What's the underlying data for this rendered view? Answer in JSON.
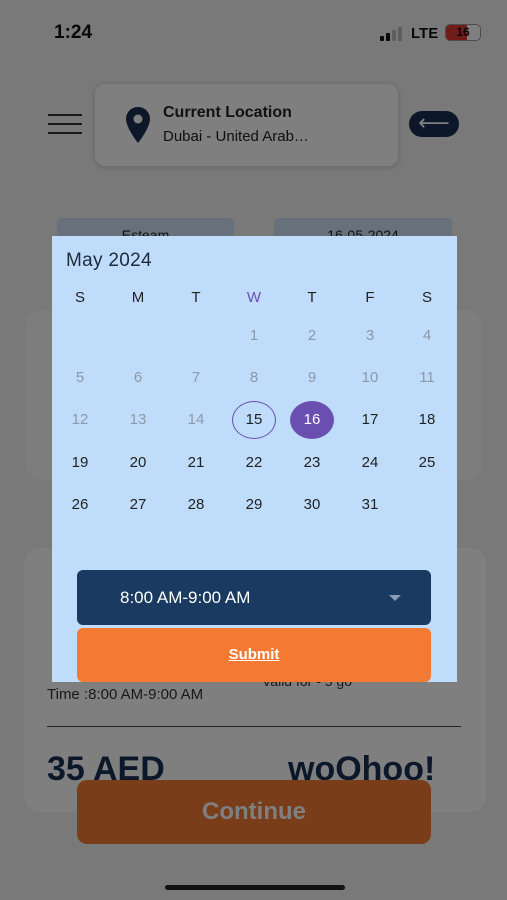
{
  "status": {
    "time": "1:24",
    "network": "LTE",
    "battery": "16",
    "signal_icon": "signal-icon"
  },
  "header": {
    "menu_icon": "hamburger-menu-icon",
    "location_title": "Current Location",
    "location_value": "Dubai - United Arab…",
    "back_icon": "arrow-left-icon",
    "back_glyph": "⟵"
  },
  "chips": {
    "left": "Esteam",
    "right": "16-05-2024"
  },
  "order": {
    "time_line": "Time :8:00 AM-9:00 AM",
    "valid_text": "Valid for - 5 go",
    "price": "35 AED",
    "brand": "woOhoo!",
    "continue_label": "Continue"
  },
  "calendar": {
    "title": "May 2024",
    "weekdays": [
      "S",
      "M",
      "T",
      "W",
      "T",
      "F",
      "S"
    ],
    "today_column": 3,
    "weeks": [
      [
        "",
        "",
        "",
        "1",
        "2",
        "3",
        "4"
      ],
      [
        "5",
        "6",
        "7",
        "8",
        "9",
        "10",
        "11"
      ],
      [
        "12",
        "13",
        "14",
        "15",
        "16",
        "17",
        "18"
      ],
      [
        "19",
        "20",
        "21",
        "22",
        "23",
        "24",
        "25"
      ],
      [
        "26",
        "27",
        "28",
        "29",
        "30",
        "31",
        ""
      ]
    ],
    "disabled_days": [
      "1",
      "2",
      "3",
      "4",
      "5",
      "6",
      "7",
      "8",
      "9",
      "10",
      "11",
      "12",
      "13",
      "14"
    ],
    "today_day": "15",
    "selected_day": "16",
    "time_slot": "8:00 AM-9:00 AM",
    "submit_label": "Submit"
  },
  "colors": {
    "primary_navy": "#1b3a62",
    "accent_orange": "#f47a33",
    "selected_purple": "#6b4fb0",
    "dialog_background": "#bfdcfb"
  }
}
